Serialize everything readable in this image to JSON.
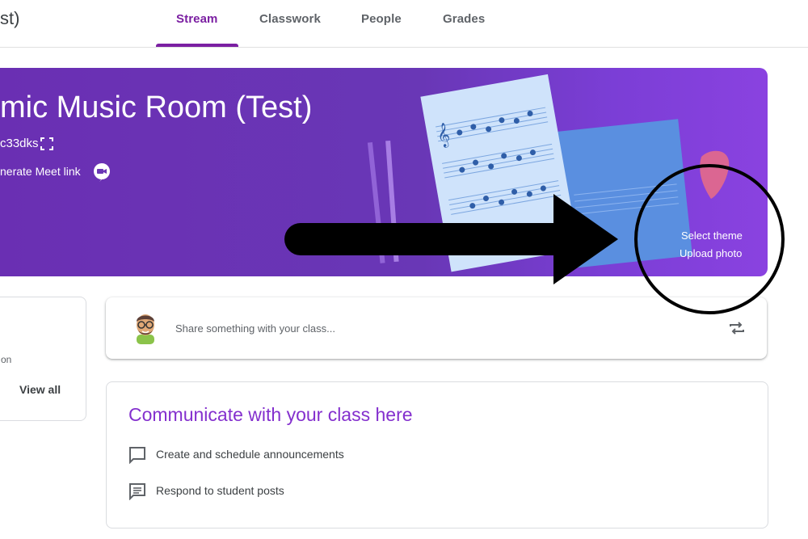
{
  "header": {
    "class_title_fragment": "st)",
    "tabs": [
      {
        "label": "Stream",
        "active": true
      },
      {
        "label": "Classwork",
        "active": false
      },
      {
        "label": "People",
        "active": false
      },
      {
        "label": "Grades",
        "active": false
      }
    ]
  },
  "banner": {
    "title": "mic Music Room (Test)",
    "class_code": "c33dks",
    "meet_link_label": "nerate Meet link",
    "select_theme_label": "Select theme",
    "upload_photo_label": "Upload photo"
  },
  "upcoming": {
    "text_fragment": "on",
    "view_all_label": "View all"
  },
  "share": {
    "placeholder": "Share something with your class..."
  },
  "communicate": {
    "title": "Communicate with your class here",
    "items": [
      {
        "label": "Create and schedule announcements",
        "icon": "announcement-icon"
      },
      {
        "label": "Respond to student posts",
        "icon": "comment-icon"
      }
    ]
  },
  "colors": {
    "accent": "#7b1fa2",
    "banner": "#6a36b5",
    "title": "#8430ce"
  }
}
